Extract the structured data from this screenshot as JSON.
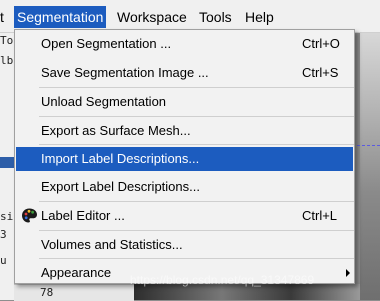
{
  "menubar": {
    "items": [
      {
        "label": "t"
      },
      {
        "label": "Segmentation"
      },
      {
        "label": "Workspace"
      },
      {
        "label": "Tools"
      },
      {
        "label": "Help"
      }
    ]
  },
  "background": {
    "fragments": [
      "To",
      "lb",
      "si",
      "3",
      "u",
      "78"
    ]
  },
  "menu": {
    "items": [
      {
        "label": "Open Segmentation ...",
        "shortcut": "Ctrl+O"
      },
      {
        "label": "Save Segmentation Image ...",
        "shortcut": "Ctrl+S"
      },
      {
        "label": "Unload Segmentation",
        "shortcut": ""
      },
      {
        "label": "Export as Surface Mesh...",
        "shortcut": ""
      },
      {
        "label": "Import Label Descriptions...",
        "shortcut": ""
      },
      {
        "label": "Export Label Descriptions...",
        "shortcut": ""
      },
      {
        "label": "Label Editor ...",
        "shortcut": "Ctrl+L",
        "icon": "palette-icon"
      },
      {
        "label": "Volumes and Statistics...",
        "shortcut": ""
      },
      {
        "label": "Appearance",
        "shortcut": "",
        "submenu": true
      }
    ]
  },
  "watermark": "https://blog.csdn.net/qq_31347869",
  "colors": {
    "highlight": "#1c5cbf"
  }
}
